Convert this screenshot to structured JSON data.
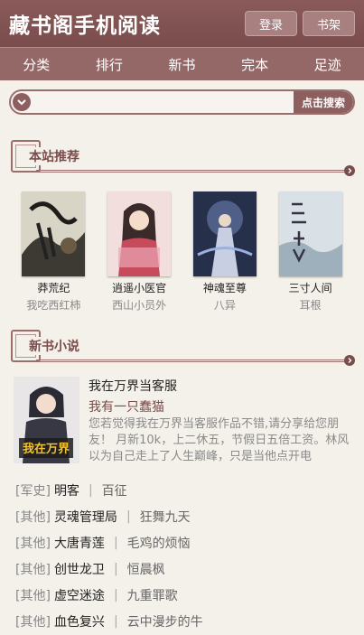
{
  "header": {
    "title": "藏书阁手机阅读",
    "login_label": "登录",
    "bookshelf_label": "书架"
  },
  "nav": [
    "分类",
    "排行",
    "新书",
    "完本",
    "足迹"
  ],
  "search": {
    "placeholder": "",
    "button_label": "点击搜索"
  },
  "recommend": {
    "title": "本站推荐",
    "books": [
      {
        "title": "莽荒纪",
        "author": "我吃西红柿"
      },
      {
        "title": "逍遥小医官",
        "author": "西山小员外"
      },
      {
        "title": "神魂至尊",
        "author": "八异"
      },
      {
        "title": "三寸人间",
        "author": "耳根"
      }
    ]
  },
  "new_books": {
    "title": "新书小说",
    "featured": {
      "title": "我在万界当客服",
      "author": "我有一只蠢猫",
      "description": "您若觉得我在万界当客服作品不错,请分享给您朋友！ 月新10k，上二休五，节假日五倍工资。林风以为自己走上了人生巅峰，只是当他点开电"
    },
    "list": [
      {
        "category": "[军史]",
        "title": "明客",
        "author": "百征"
      },
      {
        "category": "[其他]",
        "title": "灵魂管理局",
        "author": "狂舞九天"
      },
      {
        "category": "[其他]",
        "title": "大唐青莲",
        "author": "毛鸡的烦恼"
      },
      {
        "category": "[其他]",
        "title": "创世龙卫",
        "author": "恒晨枫"
      },
      {
        "category": "[其他]",
        "title": "虚空迷途",
        "author": "九重罪歌"
      },
      {
        "category": "[其他]",
        "title": "血色复兴",
        "author": "云中漫步的牛"
      }
    ]
  },
  "colors": {
    "header_bg": "#7a4c4c",
    "nav_bg": "#956868",
    "accent": "#8d5f5f",
    "page_bg": "#f4f0ea"
  }
}
